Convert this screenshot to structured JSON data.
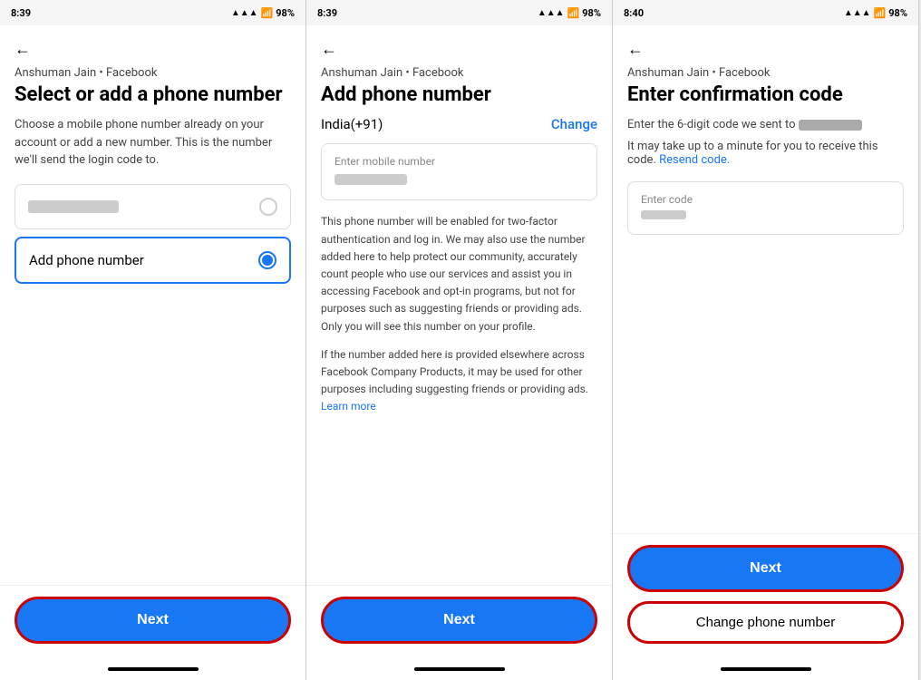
{
  "screens": [
    {
      "id": "screen1",
      "statusBar": {
        "time": "8:39",
        "battery": "98%"
      },
      "backArrow": "←",
      "accountLabel": "Anshuman Jain • Facebook",
      "title": "Select or add a phone number",
      "subtitle": "Choose a mobile phone number already on your account or add a new number. This is the number we'll send the login code to.",
      "existingNumber": {
        "blurred": true
      },
      "addPhoneLabel": "Add phone number",
      "nextButton": "Next"
    },
    {
      "id": "screen2",
      "statusBar": {
        "time": "8:39",
        "battery": "98%"
      },
      "backArrow": "←",
      "accountLabel": "Anshuman Jain • Facebook",
      "title": "Add phone number",
      "countryLabel": "India(+91)",
      "changeLink": "Change",
      "inputPlaceholder": "Enter mobile number",
      "infoText1": "This phone number will be enabled for two-factor authentication and log in. We may also use the number added here to help protect our community, accurately count people who use our services and assist you in accessing Facebook and opt-in programs, but not for purposes such as suggesting friends or providing ads. Only you will see this number on your profile.",
      "infoText2": "If the number added here is provided elsewhere across Facebook Company Products, it may be used for other purposes including suggesting friends or providing ads.",
      "learnMore": "Learn more",
      "nextButton": "Next"
    },
    {
      "id": "screen3",
      "statusBar": {
        "time": "8:40",
        "battery": "98%"
      },
      "backArrow": "←",
      "accountLabel": "Anshuman Jain • Facebook",
      "title": "Enter confirmation code",
      "subtitlePrefix": "Enter the 6-digit code we sent to",
      "subtitleSuffix": "",
      "resendPrefix": "It may take up to a minute for you to receive this code.",
      "resendLink": "Resend code.",
      "codePlaceholder": "Enter code",
      "nextButton": "Next",
      "changePhoneButton": "Change phone number"
    }
  ]
}
